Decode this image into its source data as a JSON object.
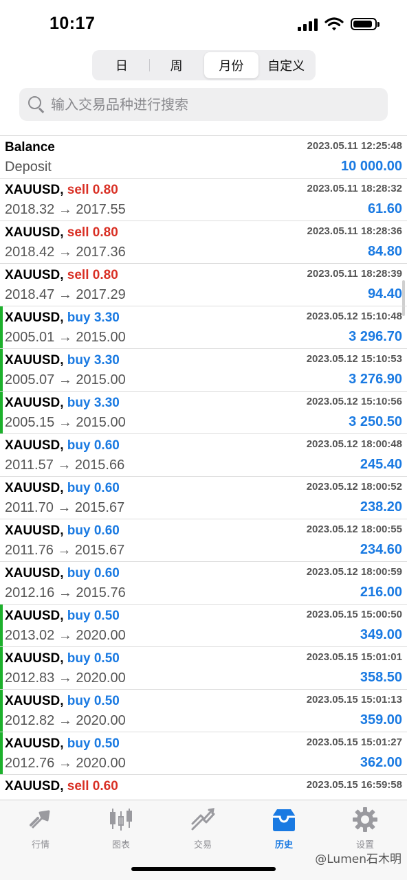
{
  "status_bar": {
    "time": "10:17",
    "battery_level": 0.9
  },
  "segmented": {
    "options": [
      {
        "label": "日",
        "selected": false
      },
      {
        "label": "周",
        "selected": false
      },
      {
        "label": "月份",
        "selected": true
      },
      {
        "label": "自定义",
        "selected": false
      }
    ]
  },
  "search": {
    "placeholder": "输入交易品种进行搜索",
    "value": ""
  },
  "colors": {
    "sell": "#d93025",
    "buy": "#1a7ae2",
    "profit": "#1a7ae2",
    "open_marker": "#1db02c"
  },
  "deals": [
    {
      "title": "Balance",
      "side": "",
      "volume": "",
      "subtitle": "Deposit",
      "time": "2023.05.11 12:25:48",
      "value": "10 000.00",
      "marker": false
    },
    {
      "title": "XAUUSD,",
      "side": "sell",
      "volume": "0.80",
      "subtitle": "2018.32 → 2017.55",
      "time": "2023.05.11 18:28:32",
      "value": "61.60",
      "marker": false
    },
    {
      "title": "XAUUSD,",
      "side": "sell",
      "volume": "0.80",
      "subtitle": "2018.42 → 2017.36",
      "time": "2023.05.11 18:28:36",
      "value": "84.80",
      "marker": false
    },
    {
      "title": "XAUUSD,",
      "side": "sell",
      "volume": "0.80",
      "subtitle": "2018.47 → 2017.29",
      "time": "2023.05.11 18:28:39",
      "value": "94.40",
      "marker": false
    },
    {
      "title": "XAUUSD,",
      "side": "buy",
      "volume": "3.30",
      "subtitle": "2005.01 → 2015.00",
      "time": "2023.05.12 15:10:48",
      "value": "3 296.70",
      "marker": true
    },
    {
      "title": "XAUUSD,",
      "side": "buy",
      "volume": "3.30",
      "subtitle": "2005.07 → 2015.00",
      "time": "2023.05.12 15:10:53",
      "value": "3 276.90",
      "marker": true
    },
    {
      "title": "XAUUSD,",
      "side": "buy",
      "volume": "3.30",
      "subtitle": "2005.15 → 2015.00",
      "time": "2023.05.12 15:10:56",
      "value": "3 250.50",
      "marker": true
    },
    {
      "title": "XAUUSD,",
      "side": "buy",
      "volume": "0.60",
      "subtitle": "2011.57 → 2015.66",
      "time": "2023.05.12 18:00:48",
      "value": "245.40",
      "marker": false
    },
    {
      "title": "XAUUSD,",
      "side": "buy",
      "volume": "0.60",
      "subtitle": "2011.70 → 2015.67",
      "time": "2023.05.12 18:00:52",
      "value": "238.20",
      "marker": false
    },
    {
      "title": "XAUUSD,",
      "side": "buy",
      "volume": "0.60",
      "subtitle": "2011.76 → 2015.67",
      "time": "2023.05.12 18:00:55",
      "value": "234.60",
      "marker": false
    },
    {
      "title": "XAUUSD,",
      "side": "buy",
      "volume": "0.60",
      "subtitle": "2012.16 → 2015.76",
      "time": "2023.05.12 18:00:59",
      "value": "216.00",
      "marker": false
    },
    {
      "title": "XAUUSD,",
      "side": "buy",
      "volume": "0.50",
      "subtitle": "2013.02 → 2020.00",
      "time": "2023.05.15 15:00:50",
      "value": "349.00",
      "marker": true
    },
    {
      "title": "XAUUSD,",
      "side": "buy",
      "volume": "0.50",
      "subtitle": "2012.83 → 2020.00",
      "time": "2023.05.15 15:01:01",
      "value": "358.50",
      "marker": true
    },
    {
      "title": "XAUUSD,",
      "side": "buy",
      "volume": "0.50",
      "subtitle": "2012.82 → 2020.00",
      "time": "2023.05.15 15:01:13",
      "value": "359.00",
      "marker": true
    },
    {
      "title": "XAUUSD,",
      "side": "buy",
      "volume": "0.50",
      "subtitle": "2012.76 → 2020.00",
      "time": "2023.05.15 15:01:27",
      "value": "362.00",
      "marker": true
    },
    {
      "title": "XAUUSD,",
      "side": "sell",
      "volume": "0.60",
      "subtitle": "",
      "time": "2023.05.15 16:59:58",
      "value": "",
      "marker": false
    }
  ],
  "tabbar": {
    "items": [
      {
        "label": "行情",
        "icon": "quotes-icon",
        "active": false
      },
      {
        "label": "图表",
        "icon": "chart-candles-icon",
        "active": false
      },
      {
        "label": "交易",
        "icon": "trade-icon",
        "active": false
      },
      {
        "label": "历史",
        "icon": "history-inbox-icon",
        "active": true
      },
      {
        "label": "设置",
        "icon": "gear-icon",
        "active": false
      }
    ]
  },
  "watermark": "@Lumen石木明"
}
